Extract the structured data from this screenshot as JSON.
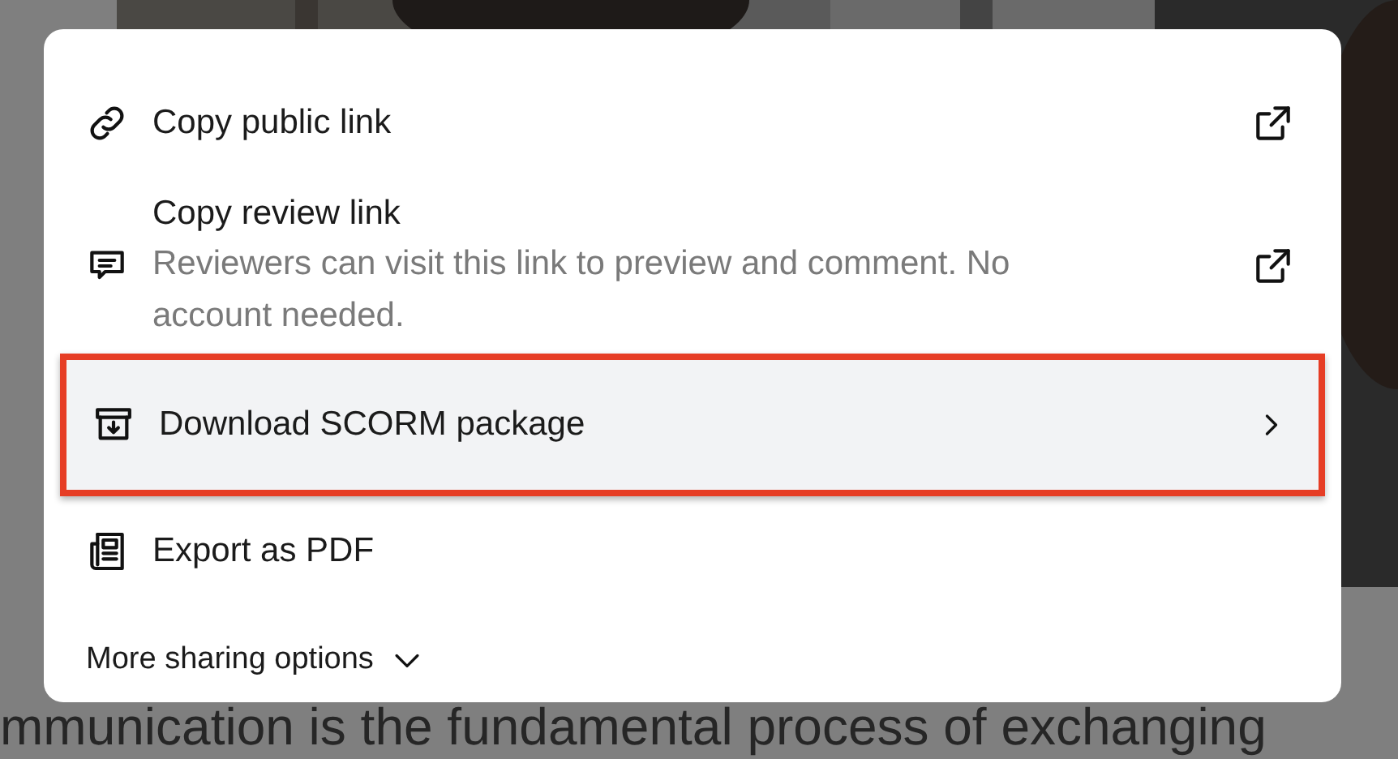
{
  "background_text": "mmunication is the fundamental process of exchanging",
  "menu": {
    "items": [
      {
        "kind": "link",
        "label": "Copy public link",
        "highlighted": false
      },
      {
        "kind": "link",
        "label": "Copy review link",
        "description": "Reviewers can visit this link to preview and comment. No account needed.",
        "highlighted": false
      },
      {
        "kind": "submenu",
        "label": "Download SCORM package",
        "highlighted": true
      },
      {
        "kind": "plain",
        "label": "Export as PDF",
        "highlighted": false
      }
    ],
    "more": {
      "label": "More sharing options",
      "expanded": false
    }
  }
}
